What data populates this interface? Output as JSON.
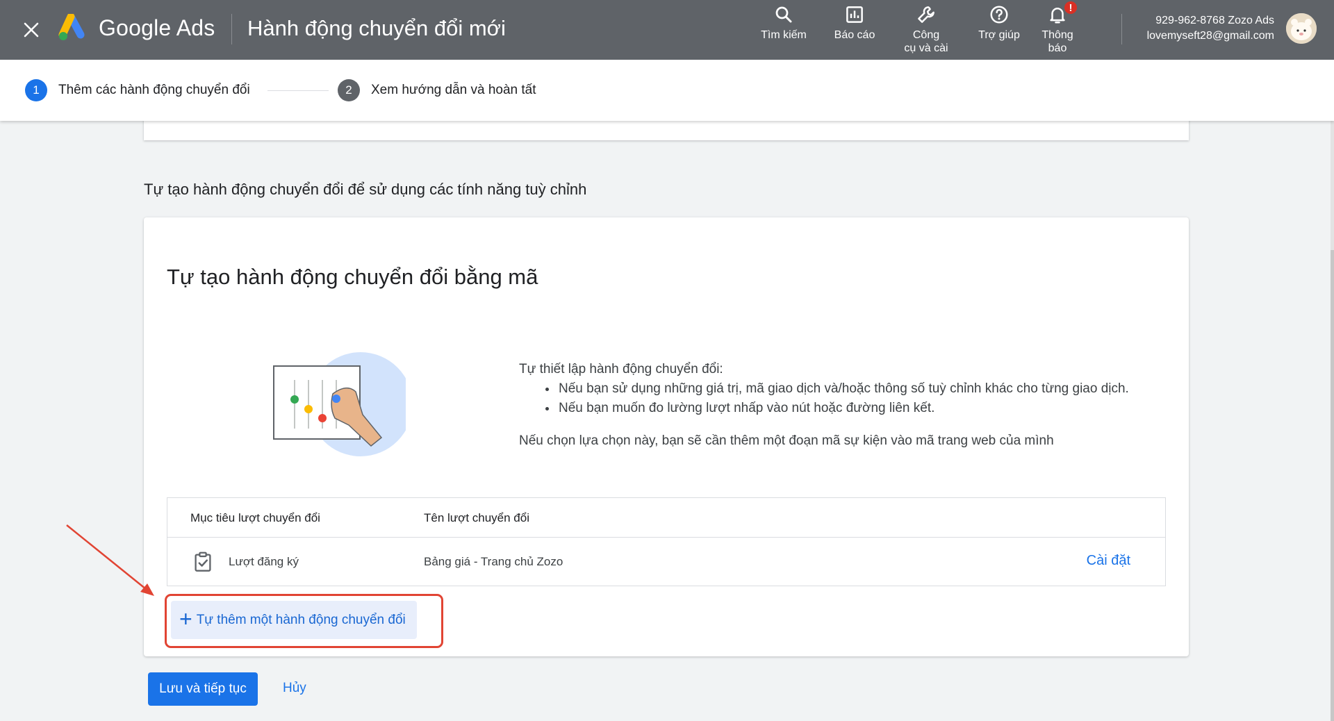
{
  "topbar": {
    "brand": "Google Ads",
    "title": "Hành động chuyển đổi mới",
    "items": [
      {
        "label": "Tìm kiếm",
        "icon": "search-icon"
      },
      {
        "label": "Báo cáo",
        "icon": "report-icon"
      },
      {
        "label": "Công\ncụ và cài",
        "icon": "wrench-icon"
      },
      {
        "label": "Trợ giúp",
        "icon": "help-icon"
      },
      {
        "label": "Thông\nbáo",
        "icon": "bell-icon"
      }
    ],
    "notification_badge": "!",
    "account_id": "929-962-8768 Zozo Ads",
    "account_email": "lovemyseft28@gmail.com"
  },
  "stepper": {
    "steps": [
      {
        "number": "1",
        "label": "Thêm các hành động chuyển đổi",
        "color": "#1a73e8"
      },
      {
        "number": "2",
        "label": "Xem hướng dẫn và hoàn tất",
        "color": "#5f6368"
      }
    ]
  },
  "main": {
    "section_heading": "Tự tạo hành động chuyển đổi để sử dụng các tính năng tuỳ chỉnh",
    "card": {
      "title": "Tự tạo hành động chuyển đổi bằng mã",
      "intro": "Tự thiết lập hành động chuyển đổi:",
      "bullets": [
        "Nếu bạn sử dụng những giá trị, mã giao dịch và/hoặc thông số tuỳ chỉnh khác cho từng giao dịch.",
        "Nếu bạn muốn đo lường lượt nhấp vào nút hoặc đường liên kết."
      ],
      "note": "Nếu chọn lựa chọn này, bạn sẽ cần thêm một đoạn mã sự kiện vào mã trang web của mình",
      "table": {
        "headers": [
          "Mục tiêu lượt chuyển đổi",
          "Tên lượt chuyển đổi"
        ],
        "rows": [
          {
            "goal": "Lượt đăng ký",
            "name": "Bảng giá - Trang chủ Zozo",
            "action": "Cài đặt",
            "icon": "checklist-icon"
          }
        ]
      },
      "add_button": "Tự thêm một hành động chuyển đổi"
    },
    "save_button": "Lưu và tiếp tục",
    "cancel_button": "Hủy"
  },
  "colors": {
    "topbar": "#5f6368",
    "primary": "#1a73e8",
    "highlight": "#e14433"
  }
}
